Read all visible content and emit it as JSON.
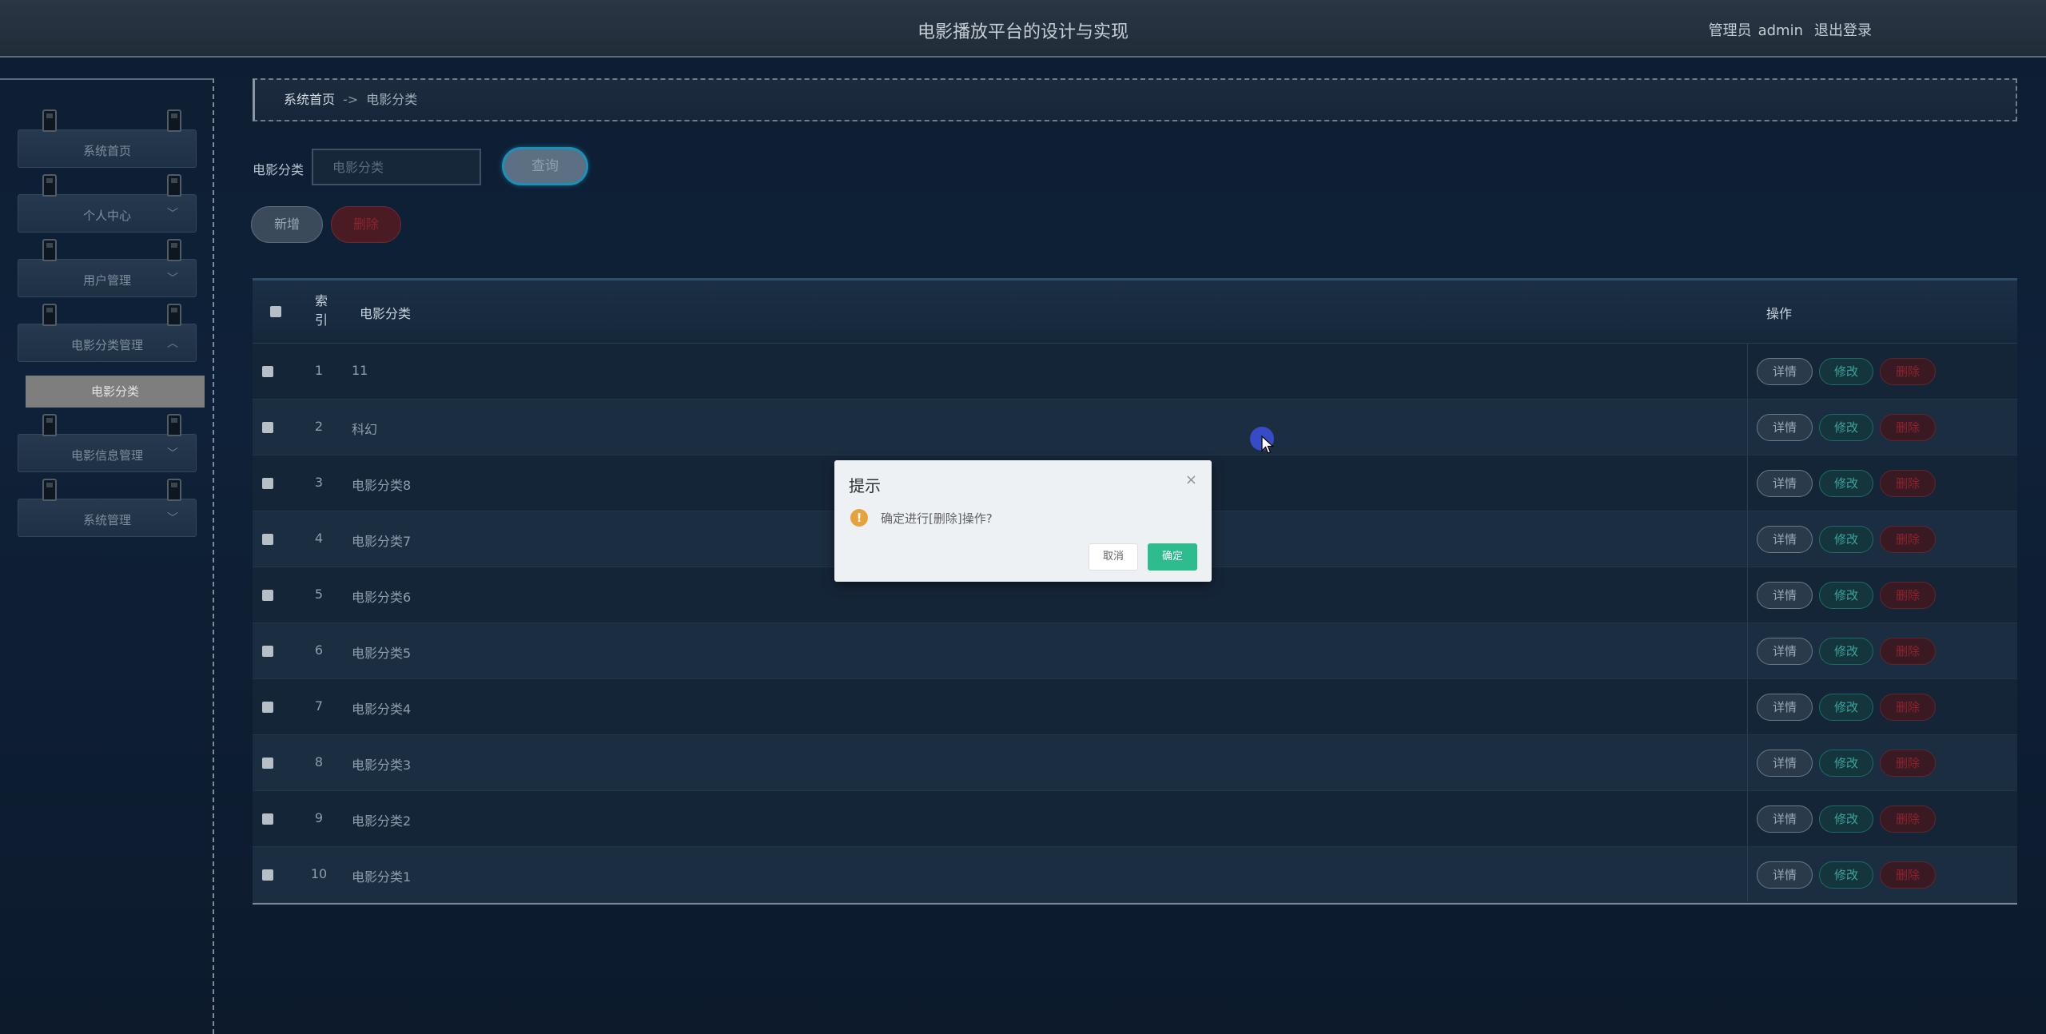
{
  "header": {
    "title": "电影播放平台的设计与实现",
    "role": "管理员",
    "username": "admin",
    "logout": "退出登录"
  },
  "sidebar": {
    "items": [
      {
        "label": "系统首页",
        "chevron": ""
      },
      {
        "label": "个人中心",
        "chevron": "﹀"
      },
      {
        "label": "用户管理",
        "chevron": "﹀"
      },
      {
        "label": "电影分类管理",
        "chevron": "︿"
      },
      {
        "label": "电影信息管理",
        "chevron": "﹀"
      },
      {
        "label": "系统管理",
        "chevron": "﹀"
      }
    ],
    "submenu_active": "电影分类"
  },
  "breadcrumb": {
    "home": "系统首页",
    "sep": "->",
    "current": "电影分类"
  },
  "search": {
    "label": "电影分类",
    "placeholder": "电影分类",
    "query_button": "查询"
  },
  "actions": {
    "add": "新增",
    "delete": "删除"
  },
  "table": {
    "headers": {
      "index_line1": "索",
      "index_line2": "引",
      "category": "电影分类",
      "ops": "操作"
    },
    "rows": [
      {
        "index": "1",
        "category": "11"
      },
      {
        "index": "2",
        "category": "科幻"
      },
      {
        "index": "3",
        "category": "电影分类8"
      },
      {
        "index": "4",
        "category": "电影分类7"
      },
      {
        "index": "5",
        "category": "电影分类6"
      },
      {
        "index": "6",
        "category": "电影分类5"
      },
      {
        "index": "7",
        "category": "电影分类4"
      },
      {
        "index": "8",
        "category": "电影分类3"
      },
      {
        "index": "9",
        "category": "电影分类2"
      },
      {
        "index": "10",
        "category": "电影分类1"
      }
    ],
    "row_ops": {
      "detail": "详情",
      "edit": "修改",
      "delete": "删除"
    }
  },
  "dialog": {
    "title": "提示",
    "message": "确定进行[删除]操作?",
    "cancel": "取消",
    "confirm": "确定",
    "close_icon": "×",
    "warning_icon": "!"
  },
  "colors": {
    "accent_teal": "#2ebc8f",
    "danger": "#8e2330",
    "warning": "#e6a23c",
    "query_border": "#1e8fb8"
  }
}
